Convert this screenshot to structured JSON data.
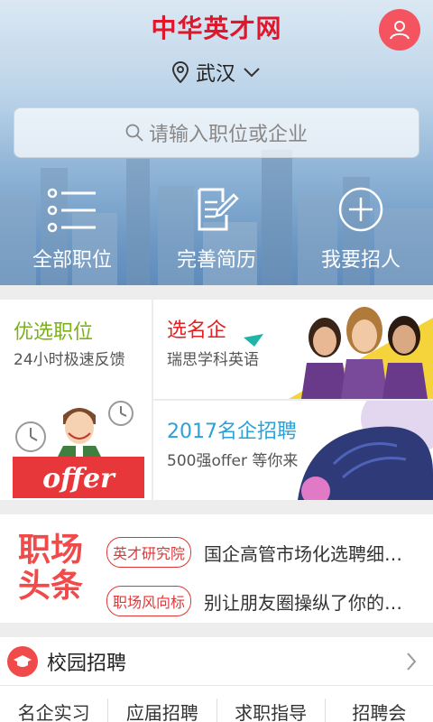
{
  "header": {
    "brand": "中华英才网",
    "city": "武汉"
  },
  "search": {
    "placeholder": "请输入职位或企业"
  },
  "quick_actions": [
    {
      "label": "全部职位",
      "icon": "list-icon"
    },
    {
      "label": "完善简历",
      "icon": "resume-edit-icon"
    },
    {
      "label": "我要招人",
      "icon": "plus-circle-icon"
    }
  ],
  "promo": {
    "left": {
      "title": "优选职位",
      "subtitle": "24小时极速反馈",
      "badge": "offer"
    },
    "top_right": {
      "title": "选名企",
      "subtitle": "瑞思学科英语"
    },
    "bottom_right": {
      "title": "2017名企招聘",
      "subtitle": "500强offer 等你来"
    }
  },
  "news": {
    "logo_line1": "职场",
    "logo_line2": "头条",
    "items": [
      {
        "tag": "英才研究院",
        "title": "国企高管市场化选聘细…"
      },
      {
        "tag": "职场风向标",
        "title": "别让朋友圈操纵了你的…"
      }
    ]
  },
  "campus": {
    "title": "校园招聘",
    "tabs": [
      "名企实习",
      "应届招聘",
      "求职指导",
      "招聘会"
    ]
  },
  "colors": {
    "brand_red": "#e0162b",
    "accent_green": "#7cb01d",
    "accent_blue": "#2aa1d8"
  }
}
